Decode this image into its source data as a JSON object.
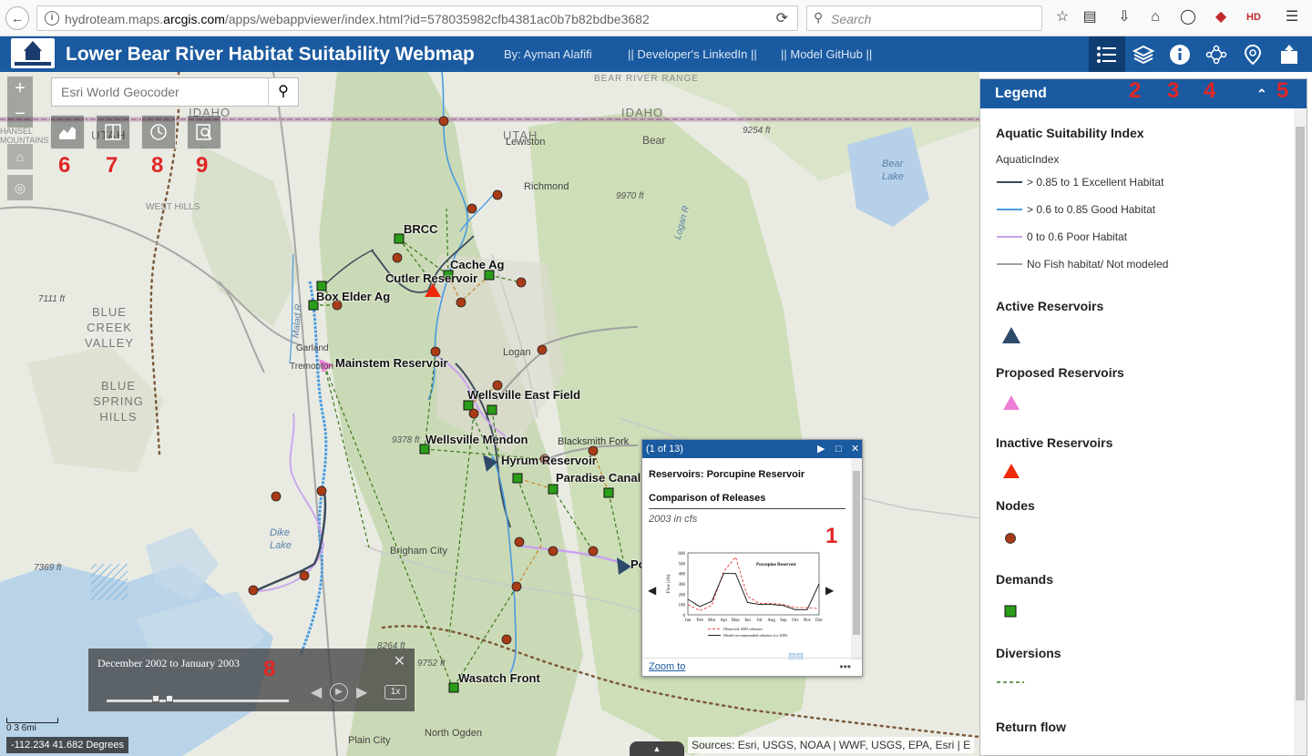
{
  "browser": {
    "url_prefix": "hydroteam.maps.",
    "url_domain": "arcgis.com",
    "url_path": "/apps/webappviewer/index.html?id=578035982cfb4381ac0b7b82bdbe3682",
    "search_placeholder": "Search"
  },
  "header": {
    "title": "Lower Bear River Habitat Suitability Webmap",
    "by": "By: Ayman Alafifi",
    "linkedin": "|| Developer's LinkedIn ||",
    "github": "|| Model GitHub ||"
  },
  "map": {
    "geocoder_placeholder": "Esri World Geocoder",
    "zoom_in": "+",
    "zoom_out": "−",
    "region_labels": [
      "IDAHO",
      "UTAH",
      "IDAHO",
      "UTAH",
      "BLUE CREEK VALLEY",
      "BLUE SPRING HILLS",
      "WEST HILLS",
      "BEAR RIVER RANGE",
      "HANSEL MOUNTAINS"
    ],
    "towns": [
      "Lewiston",
      "Richmond",
      "Bear",
      "Logan",
      "Brigham City",
      "Tremonton",
      "Garland",
      "North Ogden",
      "Plain City",
      "Dike Lake",
      "Bear Lake",
      "Logan R",
      "Malad R",
      "Blacksmith Fork"
    ],
    "elevations": [
      "9254 ft",
      "9970 ft",
      "7111 ft",
      "9378 ft",
      "7369 ft",
      "8264 ft",
      "9752 ft"
    ],
    "features": {
      "brcc": "BRCC",
      "cache_ag": "Cache Ag",
      "cutler": "Cutler Reservoir",
      "box_elder": "Box Elder Ag",
      "mainstem": "Mainstem Reservoir",
      "wellsville_east": "Wellsville East Field",
      "wellsville_mendon": "Wellsville Mendon",
      "hyrum": "Hyrum Reservoir",
      "paradise": "Paradise Canal",
      "wasatch": "Wasatch Front",
      "porcupine_abbrev": "Po"
    },
    "annotations": [
      "1",
      "6",
      "7",
      "8",
      "9",
      "8",
      "2",
      "3",
      "4",
      "5"
    ],
    "scale": "0  3  6mi",
    "coords": "-112.234 41.682 Degrees",
    "attribution": "Sources: Esri, USGS, NOAA | WWF, USGS, EPA, Esri | E"
  },
  "popup": {
    "counter": "(1 of 13)",
    "title": "Reservoirs: Porcupine Reservoir",
    "heading": "Comparison of Releases",
    "subtitle": "2003 in cfs",
    "zoom_to": "Zoom to"
  },
  "time_slider": {
    "range_text": "December 2002 to January 2003",
    "speed": "1x"
  },
  "legend": {
    "title": "Legend",
    "section1_title": "Aquatic Suitability Index",
    "section1_field": "AquaticIndex",
    "items": [
      {
        "label": "> 0.85 to 1 Excellent Habitat",
        "color": "#3d4b5c"
      },
      {
        "label": "> 0.6 to 0.85 Good Habitat",
        "color": "#4a9be0"
      },
      {
        "label": "0 to 0.6 Poor Habitat",
        "color": "#c9a2ef"
      },
      {
        "label": "No Fish habitat/ Not modeled",
        "color": "#a0a0a0"
      }
    ],
    "active_reservoirs": "Active Reservoirs",
    "proposed_reservoirs": "Proposed Reservoirs",
    "inactive_reservoirs": "Inactive Reservoirs",
    "nodes": "Nodes",
    "demands": "Demands",
    "diversions": "Diversions",
    "return_flow": "Return flow",
    "colors": {
      "active": "#2e4a6b",
      "proposed": "#ee7fd6",
      "inactive": "#ee2a0a",
      "node": "#a93b16",
      "demand": "#2a9d1a",
      "diversion": "#3a7a1a"
    }
  },
  "chart_data": {
    "type": "line",
    "title": "Porcupine Reservoir",
    "xlabel": "",
    "ylabel": "Flow (cfs)",
    "categories": [
      "Jan",
      "Feb",
      "Mar",
      "Apr",
      "May",
      "Jun",
      "Jul",
      "Aug",
      "Sep",
      "Oct",
      "Nov",
      "Dec"
    ],
    "ylim": [
      0,
      600
    ],
    "yticks": [
      "600",
      "500",
      "400",
      "300",
      "200",
      "100",
      "0"
    ],
    "series": [
      {
        "name": "Observed 2003 releases",
        "values": [
          100,
          40,
          90,
          420,
          560,
          180,
          110,
          110,
          100,
          70,
          70,
          60
        ]
      },
      {
        "name": "Model recommended releases for 2003",
        "values": [
          150,
          80,
          130,
          400,
          400,
          120,
          100,
          100,
          90,
          50,
          50,
          300
        ]
      }
    ]
  }
}
